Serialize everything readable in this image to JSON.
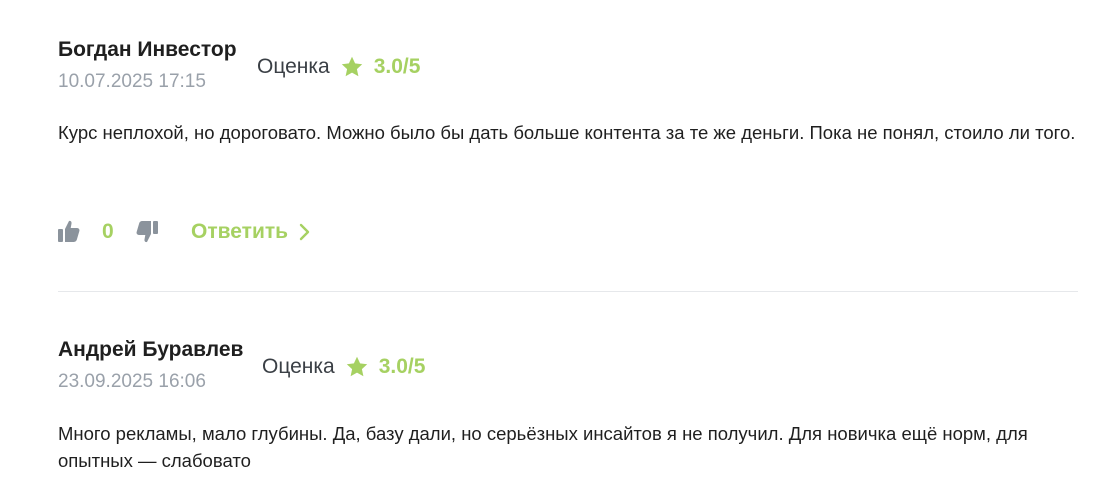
{
  "colors": {
    "accent": "#a6d162",
    "muted": "#9aa1aa",
    "icon": "#8b939c",
    "divider": "#e6e8eb"
  },
  "reviews": [
    {
      "author": "Богдан Инвестор",
      "date": "10.07.2025 17:15",
      "rating_label": "Оценка",
      "rating_value": "3.0/5",
      "text": "Курс неплохой, но дороговато. Можно было бы дать больше контента за те же деньги. Пока не понял, стоило ли того.",
      "likes": "0",
      "reply_label": "Ответить",
      "icons": [
        "thumbs-up-icon",
        "thumbs-down-icon",
        "chevron-right-icon",
        "star-icon"
      ]
    },
    {
      "author": "Андрей Буравлев",
      "date": "23.09.2025 16:06",
      "rating_label": "Оценка",
      "rating_value": "3.0/5",
      "text": "Много рекламы, мало глубины. Да, базу дали, но серьёзных инсайтов я не получил. Для новичка ещё норм, для опытных — слабовато"
    }
  ]
}
